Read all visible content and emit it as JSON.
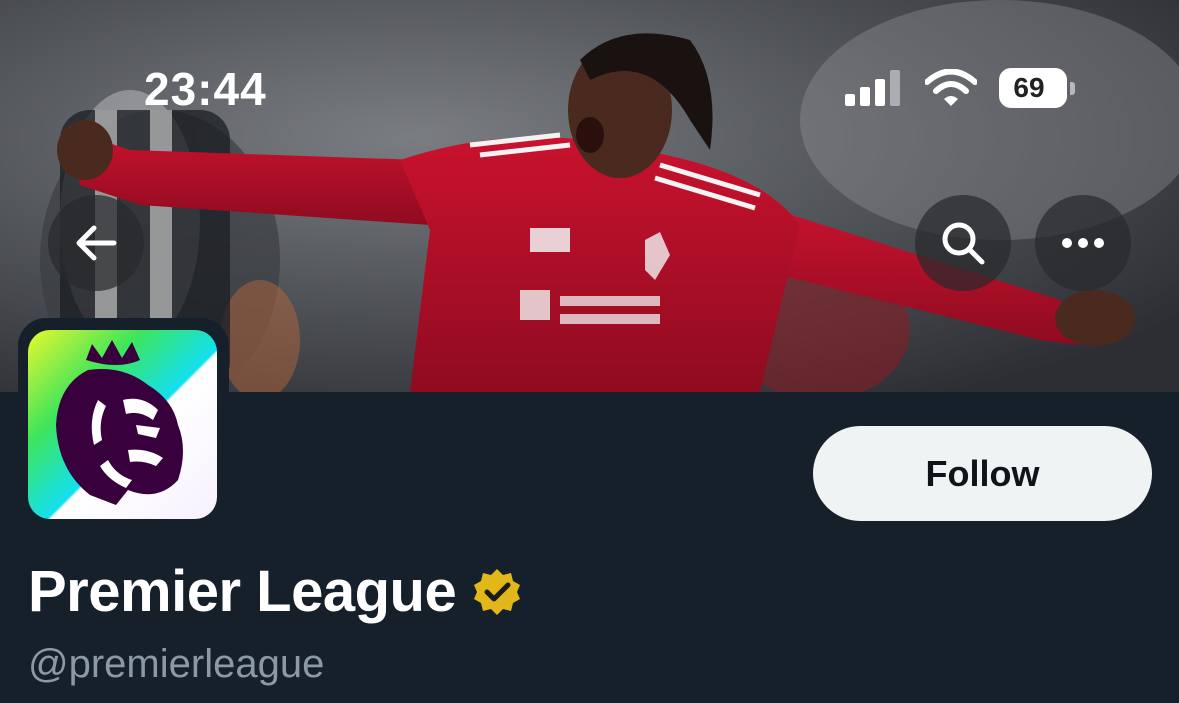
{
  "status_bar": {
    "time": "23:44",
    "battery": "69",
    "icons": [
      "signal-icon",
      "wifi-icon",
      "battery-icon"
    ]
  },
  "header_buttons": {
    "back_icon": "arrow-left-icon",
    "search_icon": "search-icon",
    "more_icon": "more-horizontal-icon"
  },
  "profile": {
    "display_name": "Premier League",
    "handle": "@premierleague",
    "verified_badge": "verified-badge-icon",
    "follow_label": "Follow"
  },
  "colors": {
    "background": "#15202b",
    "follow_button": "#eff3f4",
    "handle_text": "#8b98a5",
    "verified_gold": "#e2b719",
    "kit_red": "#c8102e"
  }
}
